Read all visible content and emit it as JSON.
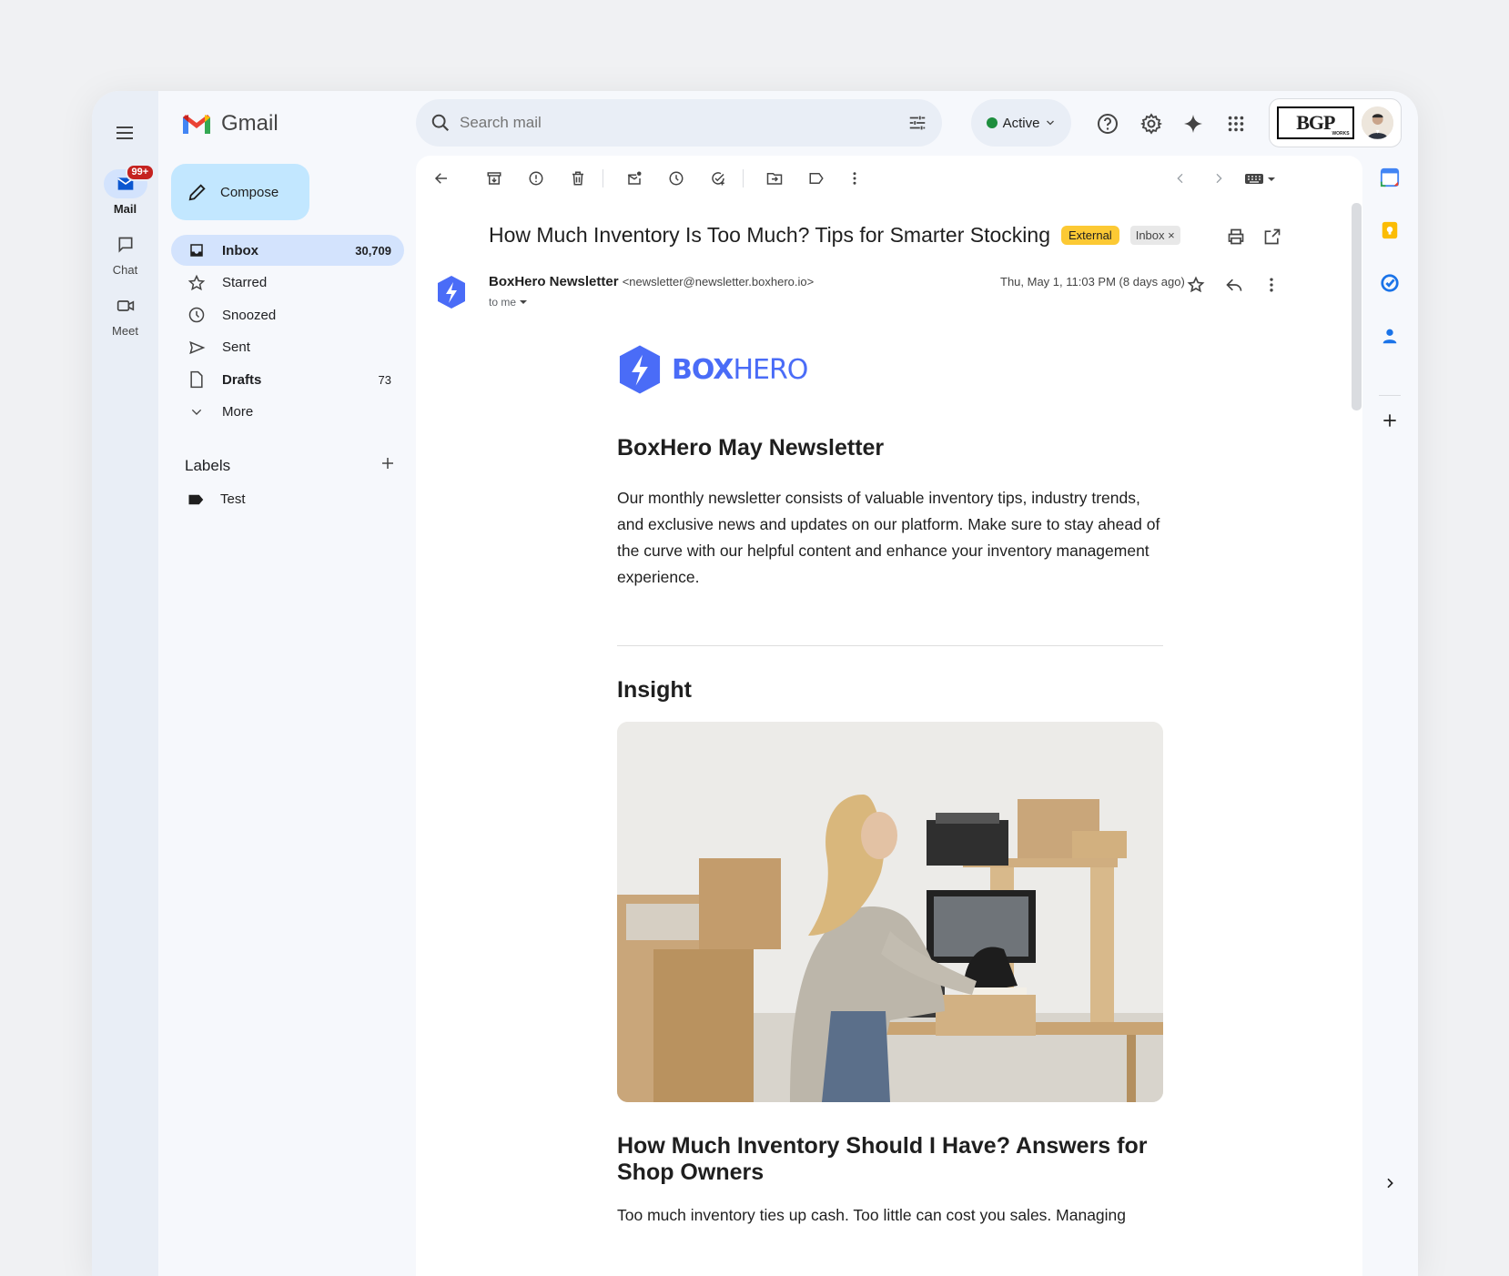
{
  "app": {
    "name": "Gmail"
  },
  "rail": {
    "mail": {
      "label": "Mail",
      "badge": "99+"
    },
    "chat": {
      "label": "Chat"
    },
    "meet": {
      "label": "Meet"
    }
  },
  "compose": {
    "label": "Compose"
  },
  "nav": {
    "items": [
      {
        "label": "Inbox",
        "count": "30,709"
      },
      {
        "label": "Starred",
        "count": ""
      },
      {
        "label": "Snoozed",
        "count": ""
      },
      {
        "label": "Sent",
        "count": ""
      },
      {
        "label": "Drafts",
        "count": "73"
      },
      {
        "label": "More",
        "count": ""
      }
    ]
  },
  "labels": {
    "title": "Labels",
    "items": [
      {
        "label": "Test"
      }
    ]
  },
  "search": {
    "placeholder": "Search mail"
  },
  "status": {
    "label": "Active"
  },
  "account": {
    "logo": "BGP",
    "logo_small": "WORKS"
  },
  "email": {
    "subject": "How Much Inventory Is Too Much? Tips for Smarter Stocking",
    "chip_external": "External",
    "chip_inbox": "Inbox",
    "chip_close": "×",
    "sender_name": "BoxHero Newsletter",
    "sender_email": "<newsletter@newsletter.boxhero.io>",
    "to": "to me",
    "date": "Thu, May 1, 11:03 PM (8 days ago)"
  },
  "newsletter": {
    "brand_bold": "BOX",
    "brand_light": "HERO",
    "title": "BoxHero May Newsletter",
    "intro": "Our monthly newsletter consists of valuable inventory tips, industry trends, and exclusive news and updates on our platform. Make sure to stay ahead of the curve with our helpful content and enhance your inventory management experience.",
    "section": "Insight",
    "article_title": "How Much Inventory Should I Have? Answers for Shop Owners",
    "article_text": "Too much inventory ties up cash. Too little can cost you sales. Managing"
  },
  "colors": {
    "accent": "#0b57d0",
    "compose": "#c2e7ff",
    "active_nav": "#d3e3fd",
    "external_chip": "#fcc934",
    "brand": "#4a6cf7"
  }
}
